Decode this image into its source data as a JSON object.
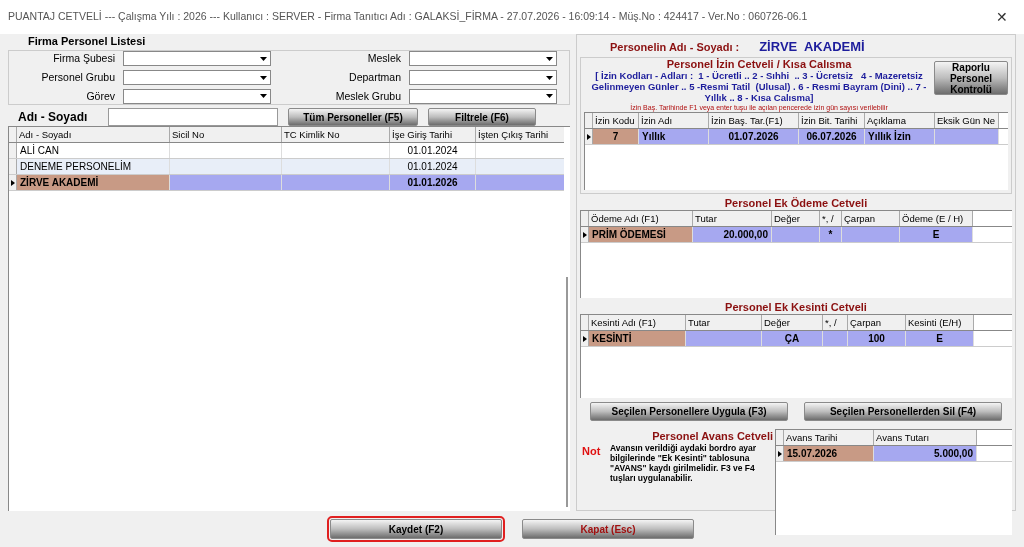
{
  "window": {
    "title": "PUANTAJ CETVELİ  ---  Çalışma Yılı : 2026  ---  Kullanıcı : SERVER - Firma Tanıtıcı Adı : GALAKSİ_FİRMA - 27.07.2026 - 16:09:14 - Müş.No : 424417 - Ver.No : 060726-06.1",
    "close": "✕"
  },
  "filter": {
    "title": "Firma Personel Listesi",
    "fields": [
      {
        "label": "Firma Şubesi"
      },
      {
        "label": "Meslek"
      },
      {
        "label": "Personel Grubu"
      },
      {
        "label": "Departman"
      },
      {
        "label": "Görev"
      },
      {
        "label": "Meslek Grubu"
      }
    ]
  },
  "search": {
    "label": "Adı - Soyadı",
    "buttons": [
      "Tüm Personeller (F5)",
      "Filtrele (F6)"
    ]
  },
  "personnel": {
    "columns": [
      "Adı - Soyadı",
      "Sicil No",
      "TC Kimlik No",
      "İşe Giriş Tarihi",
      "İşten Çıkış Tarihi"
    ],
    "rows": [
      {
        "selected": false,
        "cells": [
          "ALİ CAN",
          "",
          "",
          "01.01.2024",
          ""
        ]
      },
      {
        "selected": false,
        "cells": [
          "DENEME PERSONELİM",
          "",
          "",
          "01.01.2024",
          ""
        ]
      },
      {
        "selected": true,
        "cells": [
          "ZİRVE  AKADEMİ",
          "",
          "",
          "01.01.2026",
          ""
        ]
      }
    ]
  },
  "person": {
    "label": "Personelin Adı - Soyadı :",
    "name": "ZİRVE  AKADEMİ"
  },
  "leave": {
    "title": "Personel İzin Cetveli / Kısa Calısma",
    "codes": "[ İzin Kodları - Adları :  1 - Ücretli .. 2 - Sıhhi  .. 3 - Ücretsiz   4 - Mazeretsiz Gelinmeyen Günler .. 5 -Resmi Tatil  (Ulusal) . 6 - Resmi Bayram (Dini) .. 7 - Yıllık .. 8 - Kısa Calısma]",
    "hint": "İzin Baş. Tarihinde F1 veya enter tuşu ile açılan pencerede izin gün sayısı verilebilir",
    "button": "Raporlu Personel Kontrolü",
    "columns": [
      "İzin Kodu",
      "İzin Adı",
      "İzin Baş. Tar.(F1)",
      "İzin Bit. Tarihi",
      "Açıklama",
      "Eksik Gün Ne"
    ],
    "rows": [
      {
        "selected": true,
        "cells": [
          "7",
          "Yıllık",
          "01.07.2026",
          "06.07.2026",
          "Yıllık İzin",
          ""
        ]
      }
    ]
  },
  "payments": {
    "title": "Personel Ek Ödeme Cetveli",
    "columns": [
      "Ödeme Adı (F1)",
      "Tutar",
      "Değer",
      "*, /",
      "Çarpan",
      "Ödeme (E / H)"
    ],
    "rows": [
      {
        "selected": true,
        "cells": [
          "PRİM ÖDEMESİ",
          "20.000,00",
          "",
          "*",
          "",
          "E"
        ]
      }
    ]
  },
  "deductions": {
    "title": "Personel Ek Kesinti Cetveli",
    "columns": [
      "Kesinti Adı (F1)",
      "Tutar",
      "Değer",
      "*, /",
      "Çarpan",
      "Kesinti (E/H)"
    ],
    "rows": [
      {
        "selected": true,
        "cells": [
          "KESİNTİ",
          "",
          "ÇA",
          "",
          "100",
          "E"
        ]
      }
    ]
  },
  "apply_buttons": [
    "Seçilen Personellere Uygula (F3)",
    "Seçilen Personellerden Sil (F4)"
  ],
  "advance": {
    "title": "Personel Avans Cetveli",
    "note_label": "Not",
    "note": "Avansın verildiği aydaki bordro ayar bilgilerinde \"Ek Kesinti\" tablosuna \"AVANS\" kaydı girilmelidir. F3 ve F4 tuşları uygulanabilir.",
    "columns": [
      "Avans Tarihi",
      "Avans Tutarı"
    ],
    "rows": [
      {
        "selected": true,
        "cells": [
          "15.07.2026",
          "5.000,00"
        ]
      }
    ]
  },
  "footer": [
    {
      "label": "Kaydet (F2)",
      "focused": true,
      "kind": "save"
    },
    {
      "label": "Kapat (Esc)",
      "focused": false,
      "kind": "close"
    }
  ]
}
